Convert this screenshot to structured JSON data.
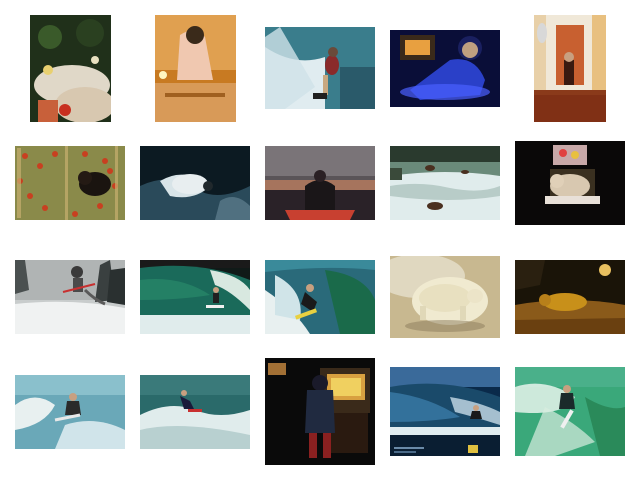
{
  "grid": {
    "rows": 4,
    "columns": 5,
    "thumbnails": [
      {
        "id": "r1c1",
        "subject": "fish-bowl-figurines",
        "palette": [
          "#1a2a12",
          "#b8a87a",
          "#c8452a"
        ]
      },
      {
        "id": "r1c2",
        "subject": "girl-in-lit-room",
        "palette": [
          "#c8741a",
          "#e8b060",
          "#f0d8c0"
        ]
      },
      {
        "id": "r1c3",
        "subject": "water-skier",
        "palette": [
          "#3a7d8c",
          "#d8e8ec",
          "#8a3030"
        ]
      },
      {
        "id": "r1c4",
        "subject": "woman-blue-light",
        "palette": [
          "#0c1040",
          "#3850d8",
          "#c0c8ff"
        ]
      },
      {
        "id": "r1c5",
        "subject": "person-in-hallway",
        "palette": [
          "#e8c080",
          "#8a3a1a",
          "#f0e8d8"
        ]
      },
      {
        "id": "r2c1",
        "subject": "bear-in-flowers",
        "palette": [
          "#6a7a3a",
          "#c84020",
          "#1a1410"
        ]
      },
      {
        "id": "r2c2",
        "subject": "polar-bear-water",
        "palette": [
          "#0c1a22",
          "#d8e4e8",
          "#3a5a6a"
        ]
      },
      {
        "id": "r2c3",
        "subject": "person-on-boat-dusk",
        "palette": [
          "#6a6468",
          "#2a2228",
          "#c84030"
        ]
      },
      {
        "id": "r2c4",
        "subject": "bears-in-river",
        "palette": [
          "#2a3a2e",
          "#e0ecec",
          "#4a3020"
        ]
      },
      {
        "id": "r2c5",
        "subject": "dog-in-dark-room",
        "palette": [
          "#0a0808",
          "#c8b8a0",
          "#e87060"
        ]
      },
      {
        "id": "r3c1",
        "subject": "snowboarder-jump",
        "palette": [
          "#d8dcdc",
          "#3a3a3a",
          "#f0f0f0"
        ]
      },
      {
        "id": "r3c2",
        "subject": "surfer-wave-barrel",
        "palette": [
          "#1a5a4a",
          "#d8e8e0",
          "#101a18"
        ]
      },
      {
        "id": "r3c3",
        "subject": "surfer-green-wave",
        "palette": [
          "#2a6a7a",
          "#e8f0f0",
          "#1a1a1a"
        ]
      },
      {
        "id": "r3c4",
        "subject": "polar-bear-figurine",
        "palette": [
          "#d8ccb0",
          "#f0e8c8",
          "#8a7a5a"
        ]
      },
      {
        "id": "r3c5",
        "subject": "animal-at-night",
        "palette": [
          "#1a1408",
          "#c8901a",
          "#e8c060"
        ]
      },
      {
        "id": "r4c1",
        "subject": "surfer-spray",
        "palette": [
          "#6aa8b8",
          "#e8f0f0",
          "#2a2a2a"
        ]
      },
      {
        "id": "r4c2",
        "subject": "surfer-turning",
        "palette": [
          "#2a6a6a",
          "#e0ecec",
          "#1a1a3a"
        ]
      },
      {
        "id": "r4c3",
        "subject": "child-playing-arcade",
        "palette": [
          "#0a0a0a",
          "#d8a040",
          "#3a4a7a"
        ]
      },
      {
        "id": "r4c4",
        "subject": "big-wave-surfer",
        "palette": [
          "#0a2a4a",
          "#3a7aa8",
          "#e0c040"
        ]
      },
      {
        "id": "r4c5",
        "subject": "surfer-green-water",
        "palette": [
          "#2a9a6a",
          "#e8f4ec",
          "#1a2a2a"
        ]
      }
    ]
  }
}
